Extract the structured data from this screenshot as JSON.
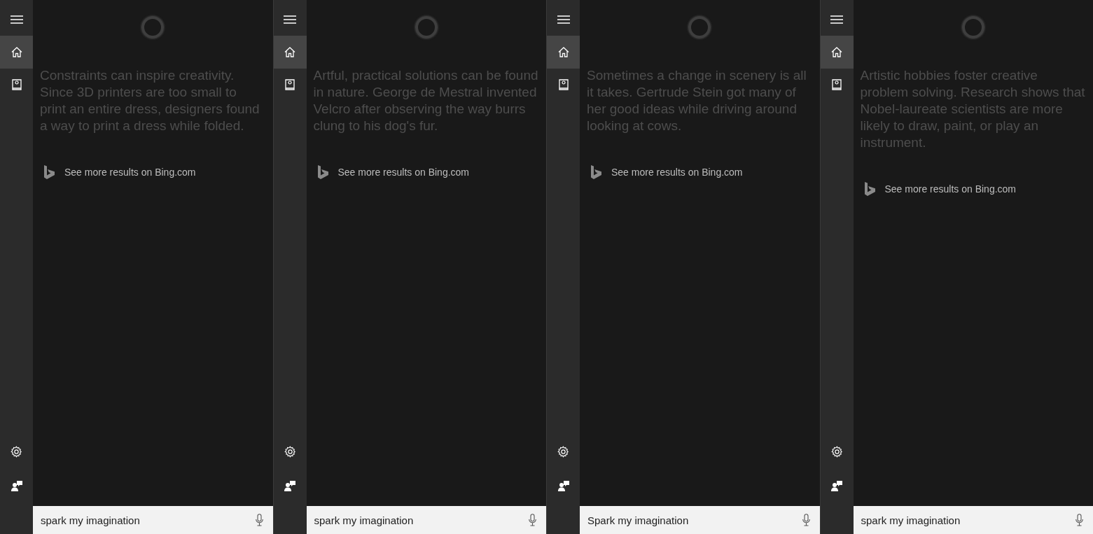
{
  "panels": [
    {
      "nav": [
        {
          "kind": "menu",
          "selected": false
        },
        {
          "kind": "home",
          "selected": true
        },
        {
          "kind": "notebook",
          "selected": false
        }
      ],
      "bottom_nav": [
        {
          "kind": "settings"
        },
        {
          "kind": "feedback"
        }
      ],
      "fact": "Constraints can inspire creativity. Since 3D printers are too small to print an entire dress, designers found a way to print a dress while folded.",
      "bing_link": "See more results on Bing.com",
      "query": "spark my imagination"
    },
    {
      "nav": [
        {
          "kind": "menu",
          "selected": false
        },
        {
          "kind": "home",
          "selected": true
        },
        {
          "kind": "notebook",
          "selected": false
        }
      ],
      "bottom_nav": [
        {
          "kind": "settings"
        },
        {
          "kind": "feedback"
        }
      ],
      "fact": "Artful, practical solutions can be found in nature. George de Mestral invented Velcro after observing the way burrs clung to his dog's fur.",
      "bing_link": "See more results on Bing.com",
      "query": "spark my imagination"
    },
    {
      "nav": [
        {
          "kind": "menu",
          "selected": false
        },
        {
          "kind": "home",
          "selected": true
        },
        {
          "kind": "notebook",
          "selected": false
        }
      ],
      "bottom_nav": [
        {
          "kind": "settings"
        },
        {
          "kind": "feedback"
        }
      ],
      "fact": "Sometimes a change in scenery is all it takes. Gertrude Stein got many of her good ideas while driving around looking at cows.",
      "bing_link": "See more results on Bing.com",
      "query": "Spark my imagination"
    },
    {
      "nav": [
        {
          "kind": "menu",
          "selected": false
        },
        {
          "kind": "home",
          "selected": true
        },
        {
          "kind": "notebook",
          "selected": false
        }
      ],
      "bottom_nav": [
        {
          "kind": "settings"
        },
        {
          "kind": "feedback"
        }
      ],
      "fact": "Artistic hobbies foster creative problem solving. Research shows that Nobel-laureate scientists are more likely to draw, paint, or play an instrument.",
      "bing_link": "See more results on Bing.com",
      "query": "spark my imagination"
    }
  ]
}
